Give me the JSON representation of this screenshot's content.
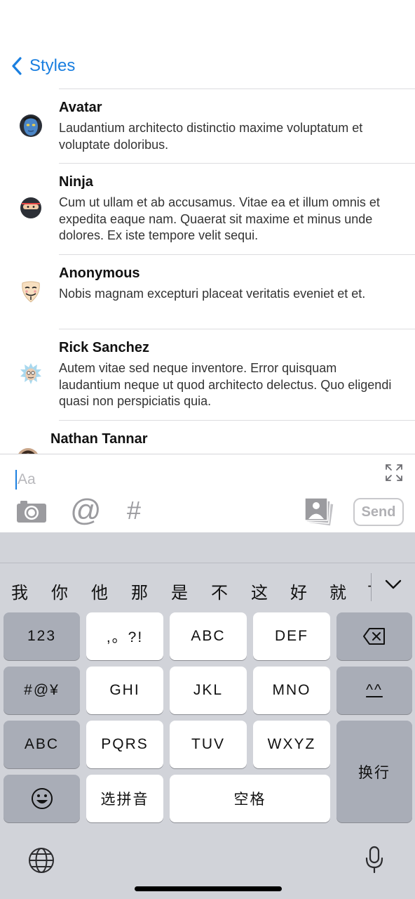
{
  "nav": {
    "back_label": "Styles"
  },
  "messages": [
    {
      "name": "Avatar",
      "text": "Laudantium architecto distinctio maxime voluptatum et voluptate doloribus.",
      "avatar": "avatar-blue-face-icon"
    },
    {
      "name": "Ninja",
      "text": "Cum ut ullam et ab accusamus. Vitae ea et illum omnis et expedita eaque nam. Quaerat sit maxime et minus unde dolores. Ex iste tempore velit sequi.",
      "avatar": "ninja-face-icon"
    },
    {
      "name": "Anonymous",
      "text": "Nobis magnam excepturi placeat veritatis eveniet et et.",
      "avatar": "guy-fawkes-mask-icon"
    },
    {
      "name": "Rick Sanchez",
      "text": "Autem vitae sed neque inventore. Error quisquam laudantium neque ut quod architecto delectus. Quo eligendi quasi non perspiciatis quia.",
      "avatar": "rick-sanchez-face-icon"
    },
    {
      "name": "Nathan Tannar",
      "text": "",
      "avatar": "person-photo-icon"
    }
  ],
  "composer": {
    "placeholder": "Aa",
    "send_label": "Send",
    "at_symbol": "@",
    "hash_symbol": "#"
  },
  "keyboard": {
    "candidates": [
      "我",
      "你",
      "他",
      "那",
      "是",
      "不",
      "这",
      "好",
      "就"
    ],
    "candidate_partial": "了",
    "keys": {
      "numbers": "123",
      "punct": ",。?!",
      "abc": "ABC",
      "def": "DEF",
      "symbols": "#@¥",
      "ghi": "GHI",
      "jkl": "JKL",
      "mno": "MNO",
      "kaomoji": "^^",
      "abc_switch": "ABC",
      "pqrs": "PQRS",
      "tuv": "TUV",
      "wxyz": "WXYZ",
      "return": "换行",
      "pinyin": "选拼音",
      "space": "空格"
    }
  }
}
